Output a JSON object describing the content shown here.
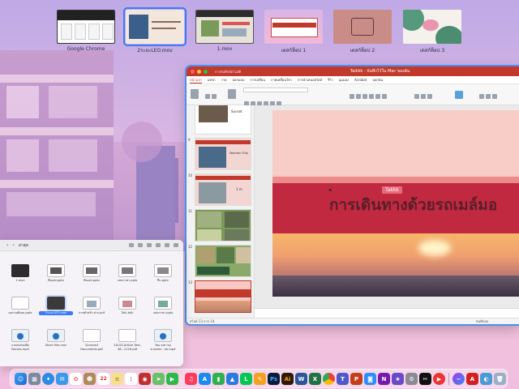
{
  "spaces": [
    {
      "label": "Google Chrome",
      "active": false
    },
    {
      "label": "2ระยะLEO.mov",
      "active": true
    },
    {
      "label": "1.mov",
      "active": false
    },
    {
      "label": "เดสก์ท็อป 1",
      "active": false
    },
    {
      "label": "เดสก์ท็อป 2",
      "active": false
    },
    {
      "label": "เดสก์ท็อป 3",
      "active": false
    }
  ],
  "powerpoint": {
    "doc_title": "Taikkk - บันทึกไว้ใน Mac ของฉัน",
    "autosave": "การบันทึกอัตโนมัติ",
    "tabs": [
      "หน้าแรก",
      "แทรก",
      "วาด",
      "ออกแบบ",
      "การเปลี่ยน",
      "ภาพเคลื่อนไหว",
      "การนำเสนอสไลด์",
      "รีวิว",
      "มุมมอง",
      "Acrobat",
      "บอกฉัน"
    ],
    "selected_tab": "หน้าแรก",
    "slide_numbers": [
      "9",
      "10",
      "11",
      "12",
      "13"
    ],
    "slide_labels": [
      "Sunset",
      "Wooden Ship",
      "1 m"
    ],
    "slide_title": "การเดินทางด้วยรถเมล์มอ",
    "slide_tag": "Takkk",
    "notes_placeholder": "คลิกเพื่อเพิ่มบันทึกย่อ",
    "status": "สไลด์ 13 จาก 14",
    "zoom_notes": "บันทึกย่อ"
  },
  "finder": {
    "title": "ล่าสุด",
    "files": [
      {
        "name": "1.mov",
        "kind": "video"
      },
      {
        "name": "พื้นเอท.pptx",
        "kind": "ppt"
      },
      {
        "name": "พื้นเอท.pptx",
        "kind": "ppt"
      },
      {
        "name": "แปลภาษา.pptx",
        "kind": "ppt"
      },
      {
        "name": "ฝึก.pptx",
        "kind": "ppt"
      },
      {
        "name": "ผลงานพัดลม.pptx",
        "kind": "doc"
      },
      {
        "name": "2ระยะLEO.mov",
        "kind": "video",
        "selected": true
      },
      {
        "name": "ภาพสำหรับ ฝาก.pdf",
        "kind": "pdf"
      },
      {
        "name": "Talk-talk",
        "kind": "doc"
      },
      {
        "name": "แปลภาษา.pptx",
        "kind": "ppt"
      },
      {
        "name": "แบบฟอร์มเพื่อ Recrea.mp4",
        "kind": "mp4"
      },
      {
        "name": "Short film.mov",
        "kind": "mp4"
      },
      {
        "name": "Scanned Documents.pdf",
        "kind": "pdf"
      },
      {
        "name": "14153-Article Text-36...1116.pdf",
        "kind": "pdf"
      },
      {
        "name": "You are my sunshin...lm.mp4",
        "kind": "mp4"
      }
    ]
  },
  "dock": {
    "calendar_day": "22",
    "apps": [
      "finder-icon",
      "launchpad-icon",
      "safari-icon",
      "mail-icon",
      "photos-icon",
      "contacts-icon",
      "calendar-icon",
      "notes-icon",
      "reminders-icon",
      "photobooth-icon",
      "maps-icon",
      "facetime-icon",
      "music-icon",
      "appstore-icon",
      "numbers-icon",
      "keynote-icon",
      "line-icon",
      "pages-icon",
      "photoshop-icon",
      "illustrator-icon",
      "word-icon",
      "excel-icon",
      "chrome-icon",
      "teams-icon",
      "powerpoint-icon",
      "zoom-icon",
      "onenote-icon",
      "imovie-icon",
      "settings-icon",
      "capcut-icon",
      "messenger-icon",
      "acrobat-icon",
      "preview-icon",
      "quicktime-icon",
      "downloads-icon",
      "trash-icon"
    ]
  }
}
